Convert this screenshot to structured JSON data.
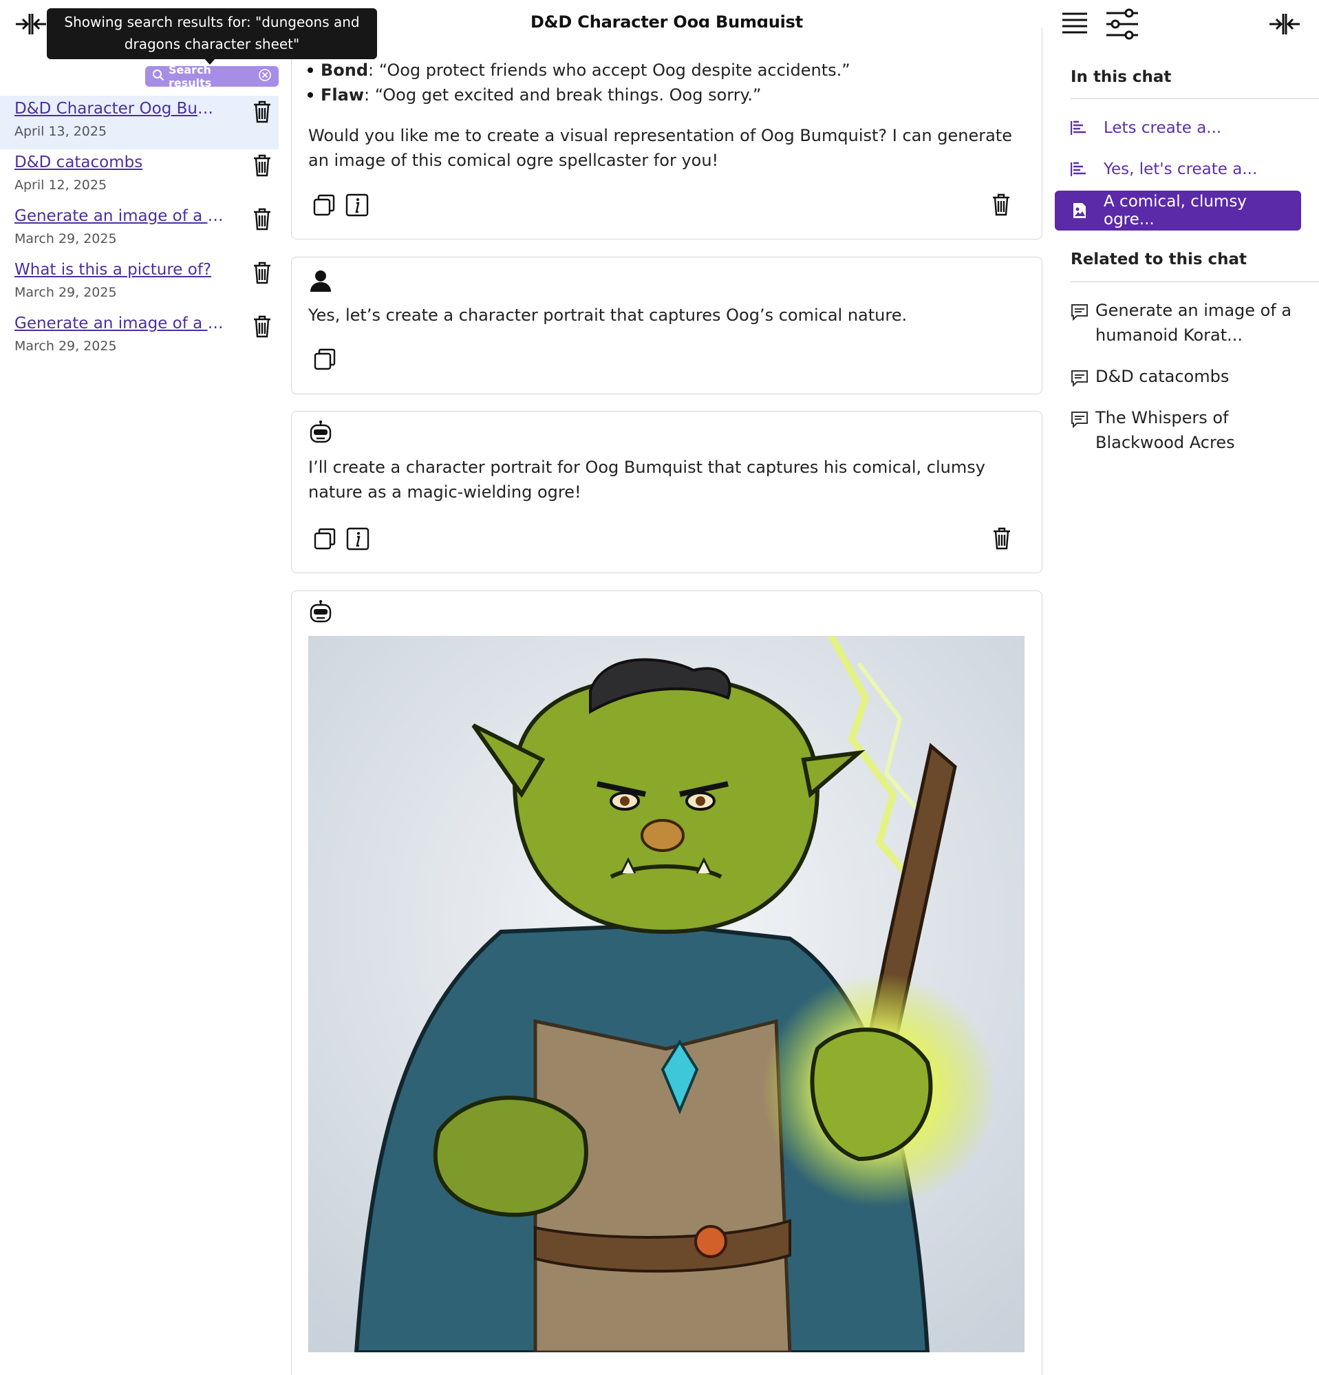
{
  "header": {
    "title": "D&D Character Oog Bumquist"
  },
  "sidebar": {
    "tooltip": "Showing search results for: \"dungeons and dragons character sheet\"",
    "search_chip": "Search results",
    "conversations": [
      {
        "title": "D&D Character Oog Bumq...",
        "date": "April 13, 2025",
        "active": true
      },
      {
        "title": "D&D catacombs",
        "date": "April 12, 2025"
      },
      {
        "title": "Generate an image of a hu...",
        "date": "March 29, 2025"
      },
      {
        "title": "What is this a picture of?",
        "date": "March 29, 2025"
      },
      {
        "title": "Generate an image of a co...",
        "date": "March 29, 2025"
      }
    ]
  },
  "chat": {
    "traits": [
      {
        "label": "Bond",
        "text": ": “Oog protect friends who accept Oog despite accidents.”"
      },
      {
        "label": "Flaw",
        "text": ": “Oog get excited and break things. Oog sorry.”"
      }
    ],
    "msg1_text": "Would you like me to create a visual representation of Oog Bumquist? I can generate an image of this comical ogre spellcaster for you!",
    "msg2_text": "Yes, let’s create a character portrait that captures Oog’s comical nature.",
    "msg3_text": "I’ll create a character portrait for Oog Bumquist that captures his comical, clumsy nature as a magic-wielding ogre!"
  },
  "right_panel": {
    "in_chat_heading": "In this chat",
    "in_chat_items": [
      {
        "label": "Lets create a...",
        "icon": "text-lines-icon"
      },
      {
        "label": "Yes, let's create a...",
        "icon": "text-lines-icon"
      },
      {
        "label": "A comical, clumsy ogre...",
        "icon": "image-icon",
        "active": true
      }
    ],
    "related_heading": "Related to this chat",
    "related_items": [
      {
        "label": "Generate an image of a humanoid Korat..."
      },
      {
        "label": "D&D catacombs"
      },
      {
        "label": "The Whispers of Blackwood Acres"
      }
    ]
  },
  "colors": {
    "accent": "#5a2aa8",
    "link": "#4b2fa0",
    "chip": "#a68ee6",
    "active_row": "#e8f0fc"
  }
}
